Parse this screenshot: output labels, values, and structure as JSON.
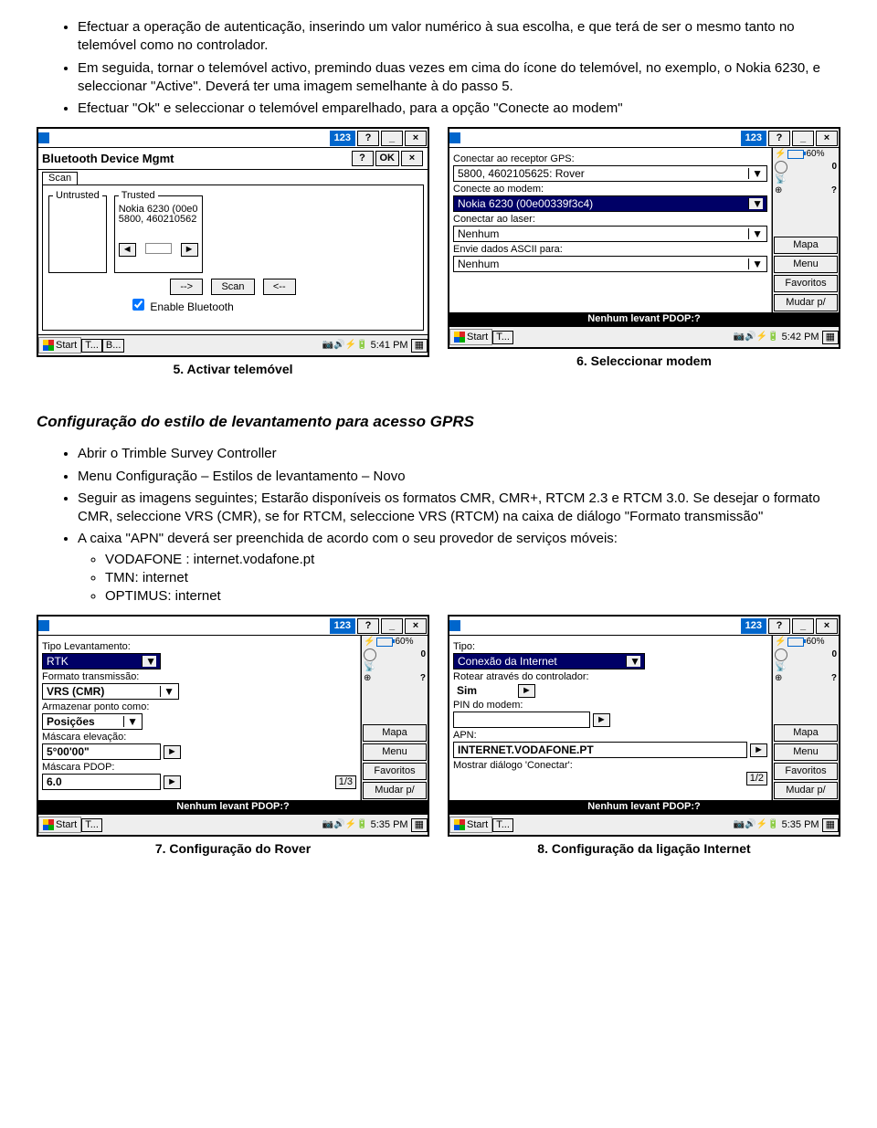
{
  "bullets_top": [
    "Efectuar a operação de autenticação, inserindo um valor numérico à sua escolha, e que terá de ser o mesmo tanto no telemóvel como no controlador.",
    "Em seguida, tornar o telemóvel activo, premindo duas vezes em cima do ícone do telemóvel, no exemplo, o Nokia 6230, e seleccionar \"Active\". Deverá ter uma imagem semelhante à do passo 5.",
    "Efectuar \"Ok\" e seleccionar o telemóvel emparelhado, para a opção \"Conecte ao modem\""
  ],
  "dev5": {
    "title": "Bluetooth Device Mgmt",
    "tab": "Scan",
    "group_untrusted": "Untrusted",
    "group_trusted": "Trusted",
    "trusted_items": [
      "Nokia 6230 (00e0",
      "5800, 460210562"
    ],
    "btn_right": "-->",
    "btn_scan": "Scan",
    "btn_left": "<--",
    "chk": "Enable Bluetooth",
    "topbar_123": "123",
    "ok": "OK",
    "help": "?",
    "close": "×",
    "start": "Start",
    "time": "5:41 PM",
    "task1": "T...",
    "task2": "B..."
  },
  "dev6": {
    "l1": "Conectar ao receptor GPS:",
    "v1": "5800, 4602105625: Rover",
    "l2": "Conecte ao modem:",
    "v2": "Nokia 6230 (00e00339f3c4)",
    "l3": "Conectar ao laser:",
    "v3": "Nenhum",
    "l4": "Envie dados ASCII para:",
    "v4": "Nenhum",
    "status": "Nenhum levant  PDOP:?",
    "side": {
      "pct": "60%",
      "zero": "0",
      "q": "?",
      "mapa": "Mapa",
      "menu": "Menu",
      "fav": "Favoritos",
      "mudar": "Mudar p/"
    },
    "topbar_123": "123",
    "start": "Start",
    "time": "5:42 PM",
    "task1": "T..."
  },
  "caption5": "5. Activar telemóvel",
  "caption6": "6. Seleccionar modem",
  "section_title": "Configuração do estilo de levantamento para acesso GPRS",
  "bullets_mid": [
    "Abrir o Trimble Survey Controller",
    "Menu Configuração – Estilos de levantamento – Novo",
    "Seguir as imagens seguintes; Estarão disponíveis os formatos CMR, CMR+, RTCM 2.3 e RTCM 3.0. Se desejar o formato CMR, seleccione VRS (CMR), se for RTCM, seleccione VRS (RTCM) na caixa de diálogo \"Formato transmissão\"",
    "A caixa \"APN\" deverá ser preenchida de acordo com o seu provedor de serviços móveis:"
  ],
  "sub_bullets": [
    "VODAFONE : internet.vodafone.pt",
    "TMN: internet",
    "OPTIMUS: internet"
  ],
  "dev7": {
    "l1": "Tipo Levantamento:",
    "v1": "RTK",
    "l2": "Formato transmissão:",
    "v2": "VRS (CMR)",
    "l3": "Armazenar ponto como:",
    "v3": "Posições",
    "l4": "Máscara elevação:",
    "v4": "5°00'00\"",
    "l5": "Máscara PDOP:",
    "v5": "6.0",
    "page": "1/3",
    "status": "Nenhum levant  PDOP:?",
    "side": {
      "pct": "60%",
      "zero": "0",
      "q": "?",
      "mapa": "Mapa",
      "menu": "Menu",
      "fav": "Favoritos",
      "mudar": "Mudar p/"
    },
    "start": "Start",
    "time": "5:35 PM",
    "task1": "T..."
  },
  "dev8": {
    "l1": "Tipo:",
    "v1": "Conexão da Internet",
    "l2": "Rotear através do controlador:",
    "v2": "Sim",
    "l3": "PIN do modem:",
    "v3": "",
    "l4": "APN:",
    "v4": "INTERNET.VODAFONE.PT",
    "l5": "Mostrar diálogo 'Conectar':",
    "v5": "",
    "page": "1/2",
    "status": "Nenhum levant  PDOP:?",
    "side": {
      "pct": "60%",
      "zero": "0",
      "q": "?",
      "mapa": "Mapa",
      "menu": "Menu",
      "fav": "Favoritos",
      "mudar": "Mudar p/"
    },
    "start": "Start",
    "time": "5:35 PM",
    "task1": "T..."
  },
  "caption7": "7. Configuração do Rover",
  "caption8": "8. Configuração da ligação Internet",
  "topbar_123": "123",
  "help": "?",
  "minimize": "_",
  "close": "×"
}
